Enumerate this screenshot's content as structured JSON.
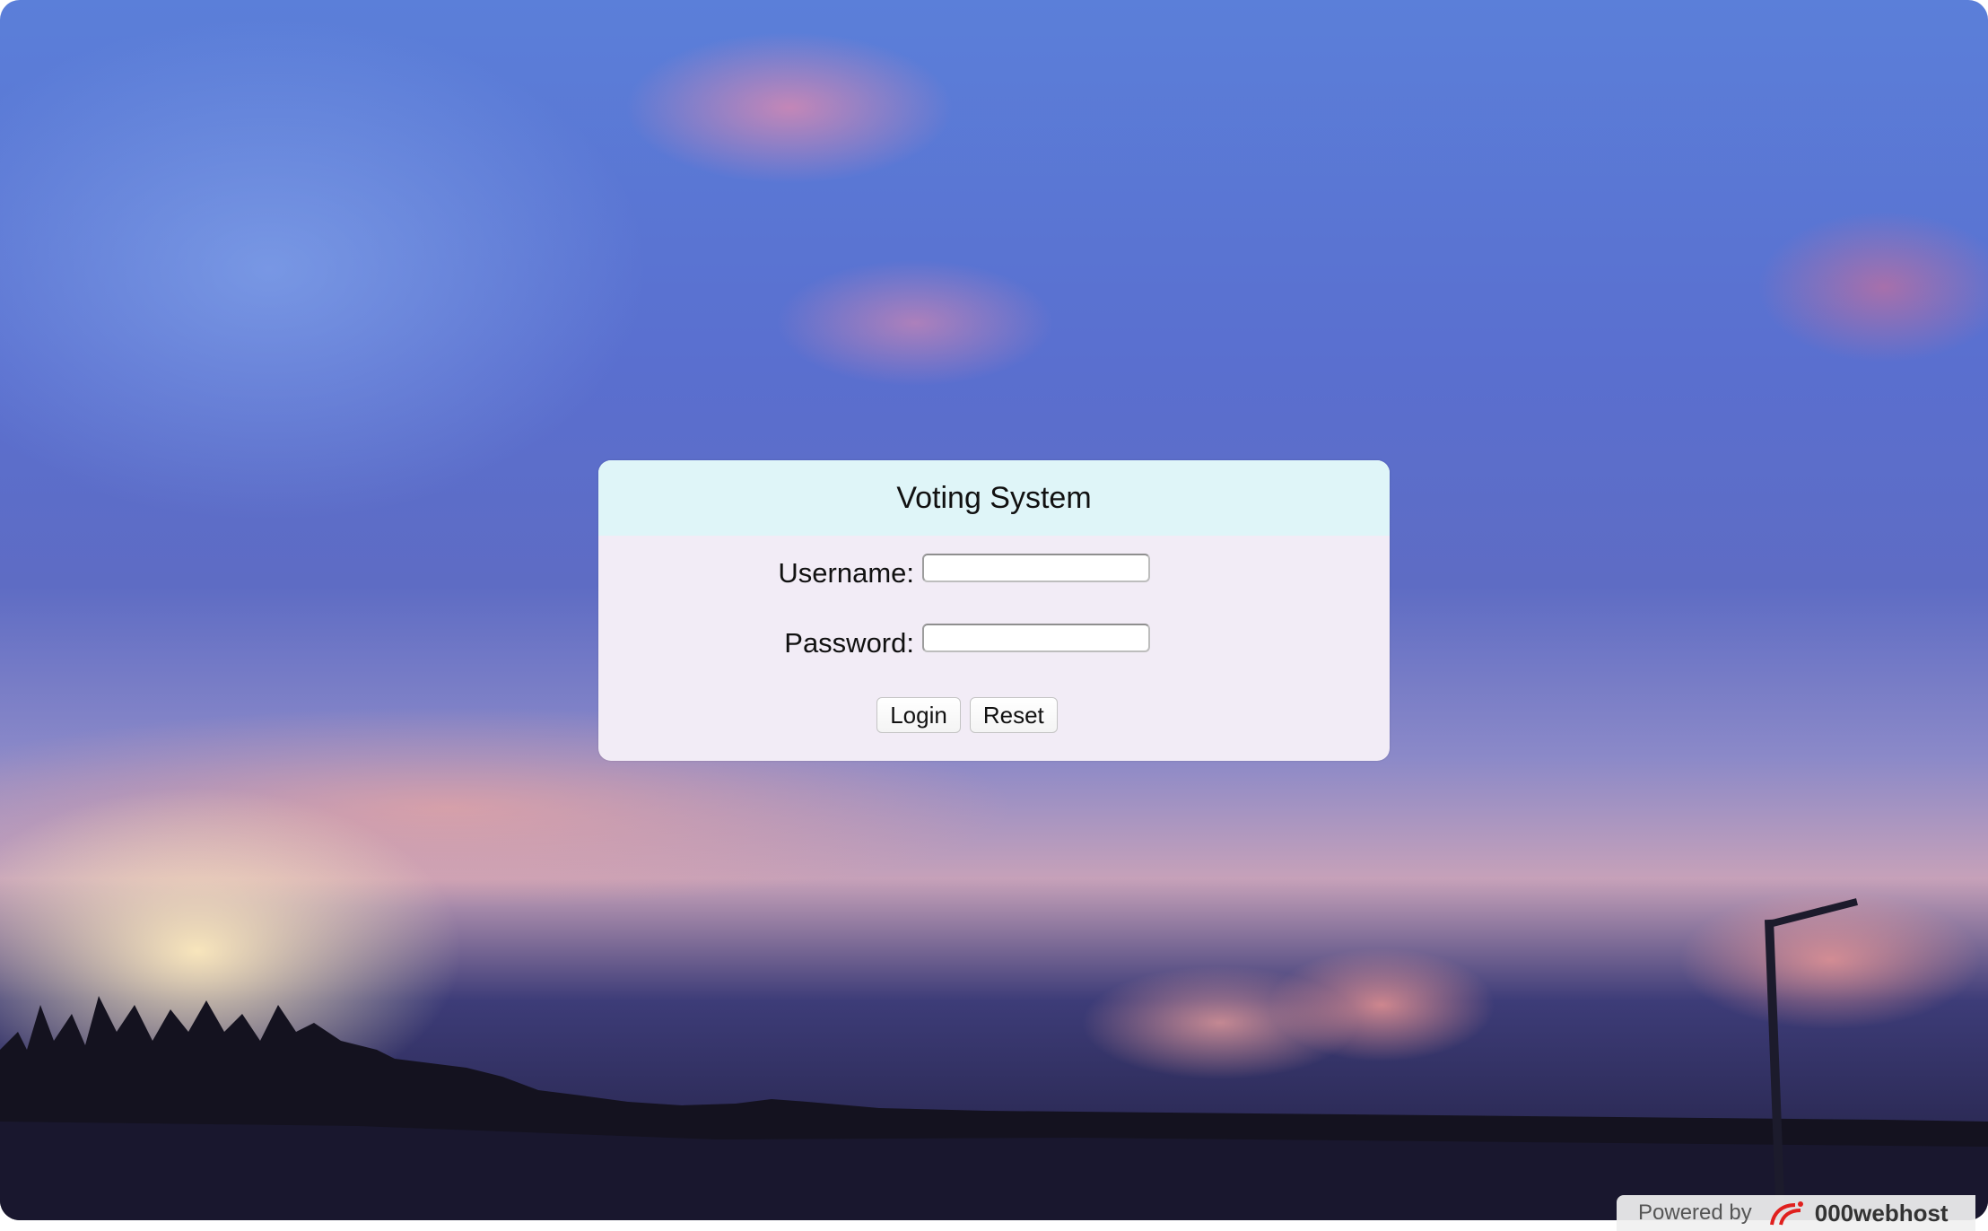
{
  "background": {
    "description_icon": "sunset-sky-photo-icon"
  },
  "login": {
    "title": "Voting System",
    "username_label": "Username:",
    "username_value": "",
    "password_label": "Password:",
    "password_value": "",
    "login_button": "Login",
    "reset_button": "Reset"
  },
  "footer": {
    "powered_by": "Powered by",
    "brand": "000webhost",
    "brand_icon": "000webhost-logo-icon",
    "brand_color": "#e0201e"
  },
  "colors": {
    "card_header_bg": "#dff5f8",
    "card_body_bg": "#f2ecf6"
  }
}
